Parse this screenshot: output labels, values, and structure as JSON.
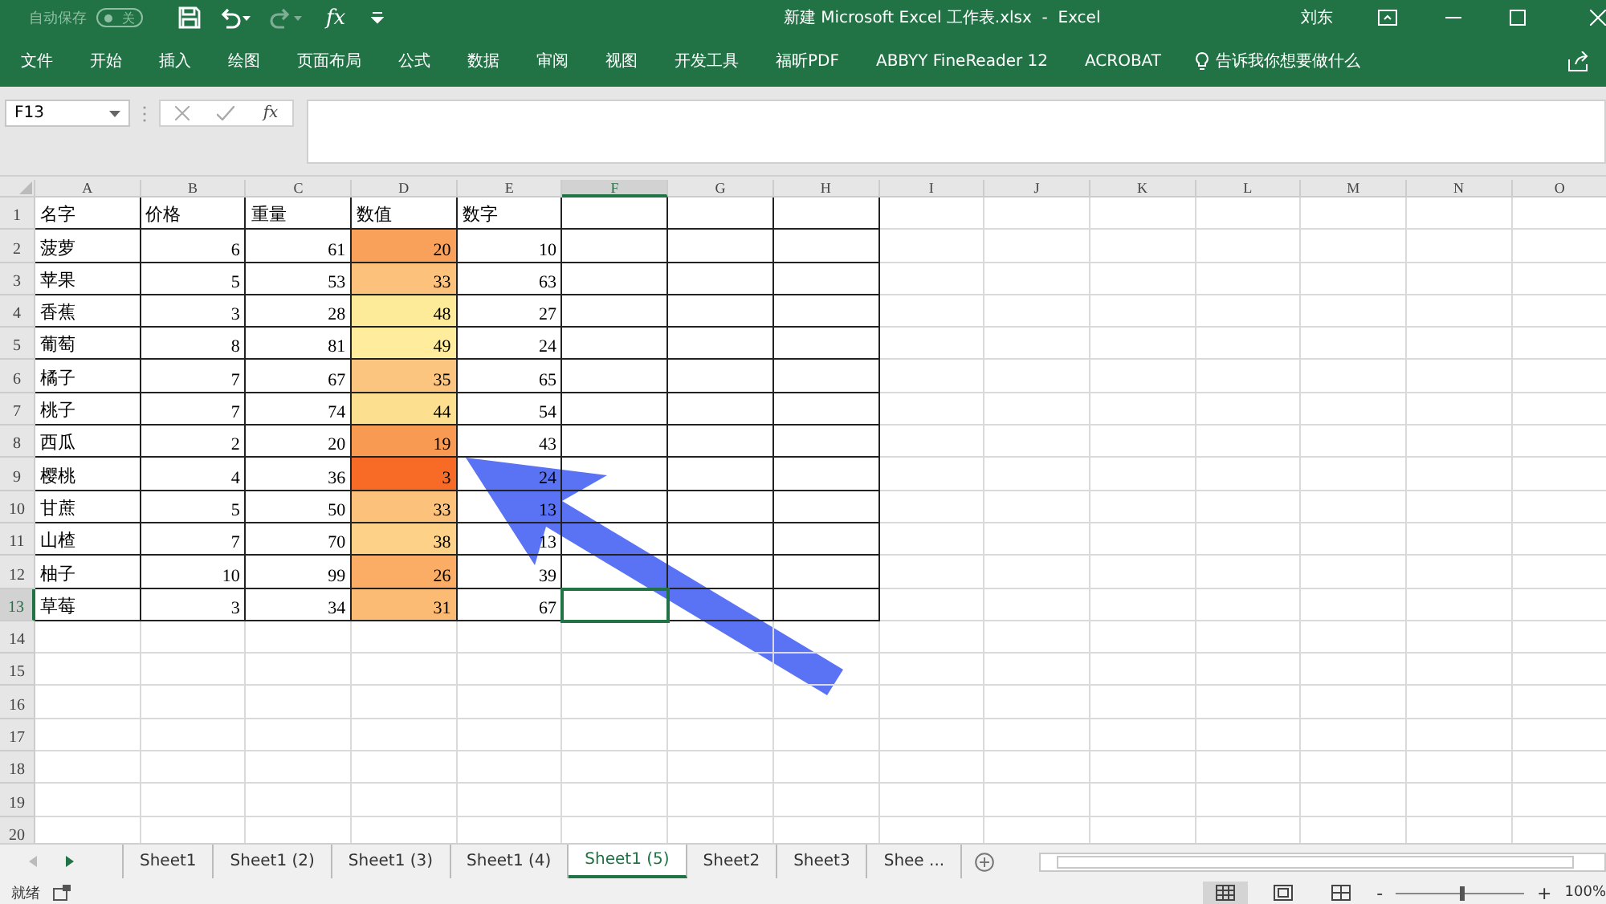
{
  "title_bar": {
    "autosave_label": "自动保存",
    "autosave_on": false,
    "autosave_state": "关",
    "insert_function": "fx",
    "title": "新建 Microsoft Excel 工作表.xlsx  -  Excel",
    "user": "刘东"
  },
  "ribbon_tabs": [
    "文件",
    "开始",
    "插入",
    "绘图",
    "页面布局",
    "公式",
    "数据",
    "审阅",
    "视图",
    "开发工具",
    "福昕PDF",
    "ABBYY FineReader 12",
    "ACROBAT"
  ],
  "tell_me": "告诉我你想要做什么",
  "formula_bar": {
    "name_box": "F13",
    "insert_function": "fx"
  },
  "columns": [
    {
      "label": "A",
      "selected": false
    },
    {
      "label": "B",
      "selected": false
    },
    {
      "label": "C",
      "selected": false
    },
    {
      "label": "D",
      "selected": false
    },
    {
      "label": "E",
      "selected": false
    },
    {
      "label": "F",
      "selected": true
    },
    {
      "label": "G",
      "selected": false
    },
    {
      "label": "H",
      "selected": false
    },
    {
      "label": "I",
      "selected": false
    },
    {
      "label": "J",
      "selected": false
    },
    {
      "label": "K",
      "selected": false
    },
    {
      "label": "L",
      "selected": false
    },
    {
      "label": "M",
      "selected": false
    },
    {
      "label": "N",
      "selected": false
    },
    {
      "label": "O",
      "selected": false
    }
  ],
  "rows": [
    {
      "number": "1",
      "selected": false,
      "kind": "header",
      "cells": [
        {
          "text": "名字"
        },
        {
          "text": "价格"
        },
        {
          "text": "重量"
        },
        {
          "text": "数值"
        },
        {
          "text": "数字"
        }
      ]
    },
    {
      "number": "2",
      "selected": false,
      "kind": "data",
      "cells": [
        {
          "text": "菠萝"
        },
        {
          "text": "6"
        },
        {
          "text": "61"
        },
        {
          "text": "20",
          "color": "#f9a15a"
        },
        {
          "text": "10"
        }
      ]
    },
    {
      "number": "3",
      "selected": false,
      "kind": "data",
      "cells": [
        {
          "text": "苹果"
        },
        {
          "text": "5"
        },
        {
          "text": "53"
        },
        {
          "text": "33",
          "color": "#fcc27c"
        },
        {
          "text": "63"
        }
      ]
    },
    {
      "number": "4",
      "selected": false,
      "kind": "data",
      "cells": [
        {
          "text": "香蕉"
        },
        {
          "text": "3"
        },
        {
          "text": "28"
        },
        {
          "text": "48",
          "color": "#feeb9a"
        },
        {
          "text": "27"
        }
      ]
    },
    {
      "number": "5",
      "selected": false,
      "kind": "data",
      "cells": [
        {
          "text": "葡萄"
        },
        {
          "text": "8"
        },
        {
          "text": "81"
        },
        {
          "text": "49",
          "color": "#ffec9c"
        },
        {
          "text": "24"
        }
      ]
    },
    {
      "number": "6",
      "selected": false,
      "kind": "data",
      "cells": [
        {
          "text": "橘子"
        },
        {
          "text": "7"
        },
        {
          "text": "67"
        },
        {
          "text": "35",
          "color": "#fcc57f"
        },
        {
          "text": "65"
        }
      ]
    },
    {
      "number": "7",
      "selected": false,
      "kind": "data",
      "cells": [
        {
          "text": "桃子"
        },
        {
          "text": "7"
        },
        {
          "text": "74"
        },
        {
          "text": "44",
          "color": "#fde08f"
        },
        {
          "text": "54"
        }
      ]
    },
    {
      "number": "8",
      "selected": false,
      "kind": "data",
      "cells": [
        {
          "text": "西瓜"
        },
        {
          "text": "2"
        },
        {
          "text": "20"
        },
        {
          "text": "19",
          "color": "#f99a52"
        },
        {
          "text": "43"
        }
      ]
    },
    {
      "number": "9",
      "selected": false,
      "kind": "data",
      "cells": [
        {
          "text": "樱桃"
        },
        {
          "text": "4"
        },
        {
          "text": "36"
        },
        {
          "text": "3",
          "color": "#f76b26"
        },
        {
          "text": "24"
        }
      ]
    },
    {
      "number": "10",
      "selected": false,
      "kind": "data",
      "cells": [
        {
          "text": "甘蔗"
        },
        {
          "text": "5"
        },
        {
          "text": "50"
        },
        {
          "text": "33",
          "color": "#fcc27c"
        },
        {
          "text": "13"
        }
      ]
    },
    {
      "number": "11",
      "selected": false,
      "kind": "data",
      "cells": [
        {
          "text": "山楂"
        },
        {
          "text": "7"
        },
        {
          "text": "70"
        },
        {
          "text": "38",
          "color": "#fdd188"
        },
        {
          "text": "13"
        }
      ]
    },
    {
      "number": "12",
      "selected": false,
      "kind": "data",
      "cells": [
        {
          "text": "柚子"
        },
        {
          "text": "10"
        },
        {
          "text": "99"
        },
        {
          "text": "26",
          "color": "#fbad66"
        },
        {
          "text": "39"
        }
      ]
    },
    {
      "number": "13",
      "selected": true,
      "kind": "data",
      "cells": [
        {
          "text": "草莓"
        },
        {
          "text": "3"
        },
        {
          "text": "34"
        },
        {
          "text": "31",
          "color": "#fbbb75"
        },
        {
          "text": "67"
        }
      ]
    },
    {
      "number": "14",
      "selected": false,
      "kind": "empty"
    },
    {
      "number": "15",
      "selected": false,
      "kind": "empty"
    },
    {
      "number": "16",
      "selected": false,
      "kind": "empty"
    },
    {
      "number": "17",
      "selected": false,
      "kind": "empty"
    },
    {
      "number": "18",
      "selected": false,
      "kind": "empty"
    },
    {
      "number": "19",
      "selected": false,
      "kind": "empty"
    },
    {
      "number": "20",
      "selected": false,
      "kind": "empty"
    }
  ],
  "sheet_tabs": [
    {
      "label": "Sheet1",
      "selected": false
    },
    {
      "label": "Sheet1 (2)",
      "selected": false
    },
    {
      "label": "Sheet1 (3)",
      "selected": false
    },
    {
      "label": "Sheet1 (4)",
      "selected": false
    },
    {
      "label": "Sheet1 (5)",
      "selected": true
    },
    {
      "label": "Sheet2",
      "selected": false
    },
    {
      "label": "Sheet3",
      "selected": false
    },
    {
      "label": "Shee ...",
      "selected": false
    }
  ],
  "status_bar": {
    "status": "就绪",
    "zoom_out": "-",
    "zoom_in": "+",
    "zoom": {
      "level": 0.5
    },
    "zoom_reading": "100%"
  },
  "annotation": {
    "kind": "arrow"
  }
}
